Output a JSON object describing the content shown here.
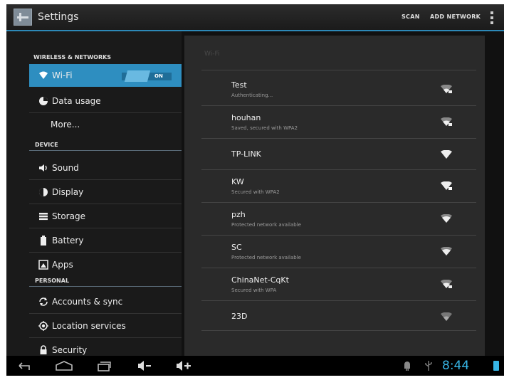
{
  "action_bar": {
    "title": "Settings",
    "scan_label": "SCAN",
    "add_network_label": "ADD NETWORK"
  },
  "sidebar": {
    "sections": [
      {
        "header": "WIRELESS & NETWORKS"
      },
      {
        "header": "DEVICE"
      },
      {
        "header": "PERSONAL"
      }
    ],
    "items": [
      {
        "label": "Wi-Fi",
        "icon": "wifi-icon",
        "toggle": "ON",
        "selected": true
      },
      {
        "label": "Data usage",
        "icon": "data-usage-icon"
      },
      {
        "label": "More..."
      },
      {
        "label": "Sound",
        "icon": "speaker-icon"
      },
      {
        "label": "Display",
        "icon": "display-icon"
      },
      {
        "label": "Storage",
        "icon": "storage-icon"
      },
      {
        "label": "Battery",
        "icon": "battery-icon"
      },
      {
        "label": "Apps",
        "icon": "apps-icon"
      },
      {
        "label": "Accounts & sync",
        "icon": "sync-icon"
      },
      {
        "label": "Location services",
        "icon": "location-icon"
      },
      {
        "label": "Security",
        "icon": "lock-icon"
      }
    ]
  },
  "wifi_panel": {
    "title": "Wi-Fi",
    "networks": [
      {
        "name": "Test",
        "status": "Authenticating...",
        "secured": true
      },
      {
        "name": "houhan",
        "status": "Saved, secured with WPA2",
        "secured": true
      },
      {
        "name": "TP-LINK",
        "status": "",
        "secured": false
      },
      {
        "name": "KW",
        "status": "Secured with WPA2",
        "secured": true
      },
      {
        "name": "pzh",
        "status": "Protected network available",
        "secured": false
      },
      {
        "name": "SC",
        "status": "Protected network available",
        "secured": false
      },
      {
        "name": "ChinaNet-CqKt",
        "status": "Secured with WPA",
        "secured": true
      },
      {
        "name": "23D",
        "status": "",
        "secured": false
      }
    ]
  },
  "nav_bar": {
    "time": "8:44",
    "buttons": [
      "back-icon",
      "home-icon",
      "recent-apps-icon",
      "volume-down-icon",
      "volume-up-icon"
    ],
    "accent": "#37b6e7"
  },
  "colors": {
    "accent": "#2e8ec0",
    "background": "#1a1a1a"
  }
}
